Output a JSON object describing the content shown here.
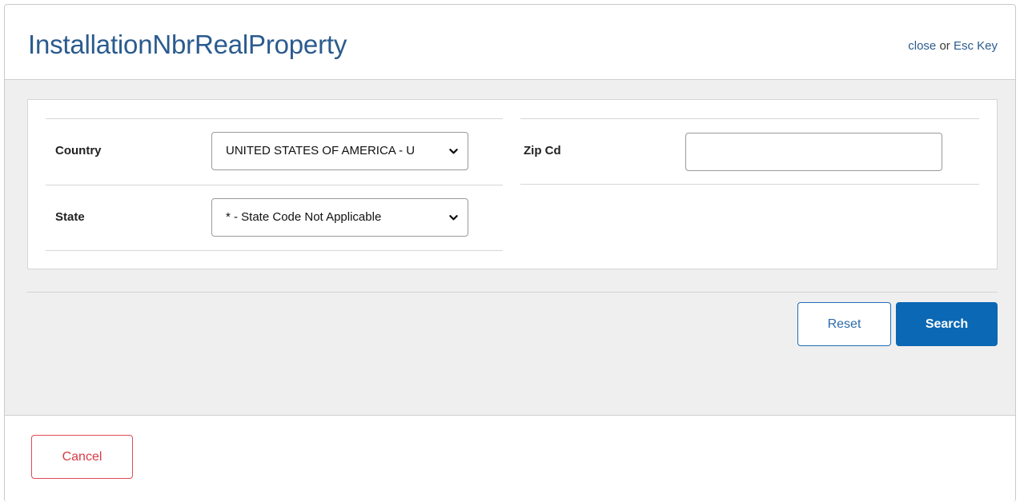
{
  "dialog": {
    "title": "InstallationNbrRealProperty",
    "close_text": "close",
    "close_sep": " or ",
    "close_key": "Esc Key"
  },
  "form": {
    "country": {
      "label": "Country",
      "value": "UNITED STATES OF AMERICA - U"
    },
    "state": {
      "label": "State",
      "value": "* - State Code Not Applicable"
    },
    "zip": {
      "label": "Zip Cd",
      "value": "",
      "placeholder": ""
    }
  },
  "actions": {
    "reset_label": "Reset",
    "search_label": "Search",
    "cancel_label": "Cancel"
  },
  "colors": {
    "title": "#2b5b8e",
    "primary": "#0b68b4",
    "danger": "#d93a47",
    "panel_bg": "#efefef"
  },
  "icons": {
    "dropdown": "chevron-down-icon"
  }
}
